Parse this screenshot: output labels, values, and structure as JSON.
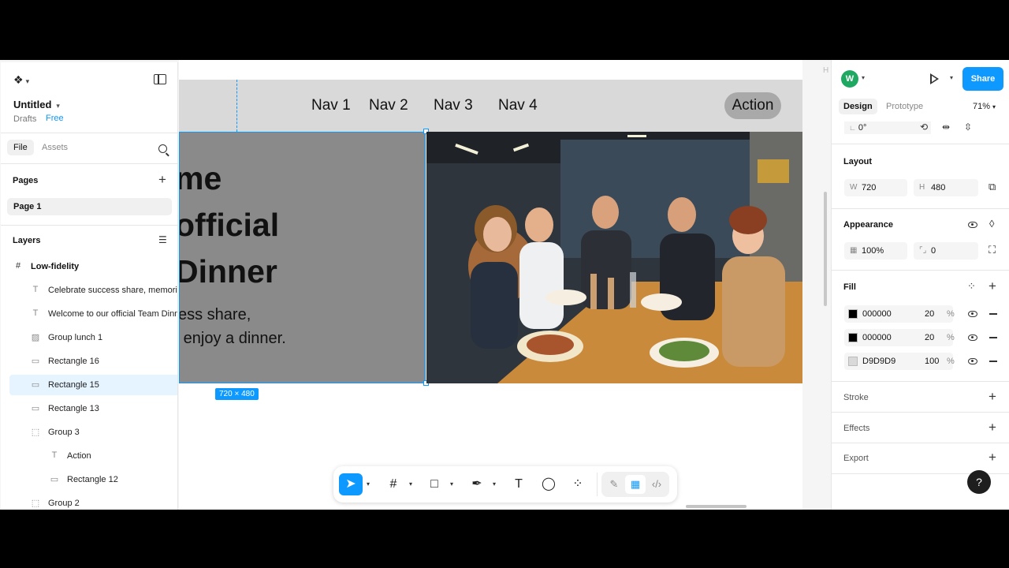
{
  "file": {
    "title": "Untitled",
    "location": "Drafts",
    "plan": "Free"
  },
  "left_tabs": {
    "file": "File",
    "assets": "Assets"
  },
  "pages": {
    "header": "Pages",
    "items": [
      "Page 1"
    ]
  },
  "layers": {
    "header": "Layers",
    "items": [
      {
        "label": "Low-fidelity",
        "icon": "#",
        "kind": "frame"
      },
      {
        "label": "Celebrate success share, memories",
        "icon": "T",
        "kind": "text"
      },
      {
        "label": "Welcome to our official Team Dinner",
        "icon": "T",
        "kind": "text"
      },
      {
        "label": "Group lunch 1",
        "icon": "▨",
        "kind": "image"
      },
      {
        "label": "Rectangle 16",
        "icon": "▭",
        "kind": "rect"
      },
      {
        "label": "Rectangle 15",
        "icon": "▭",
        "kind": "rect",
        "selected": true
      },
      {
        "label": "Rectangle 13",
        "icon": "▭",
        "kind": "rect"
      },
      {
        "label": "Group 3",
        "icon": "⬚",
        "kind": "group"
      },
      {
        "label": "Action",
        "icon": "T",
        "kind": "text",
        "indent": true
      },
      {
        "label": "Rectangle 12",
        "icon": "▭",
        "kind": "rect",
        "indent": true
      },
      {
        "label": "Group 2",
        "icon": "⬚",
        "kind": "group"
      }
    ]
  },
  "canvas": {
    "nav": [
      "Nav 1",
      "Nav 2",
      "Nav 3",
      "Nav 4"
    ],
    "action": "Action",
    "hero_lines": [
      "me",
      "official",
      "Dinner"
    ],
    "hero_sub": [
      "cess share,",
      "d enjoy a dinner."
    ],
    "size_badge": "720 × 480",
    "corner_label": "H"
  },
  "right": {
    "avatar": "W",
    "share": "Share",
    "tabs": {
      "design": "Design",
      "prototype": "Prototype"
    },
    "zoom": "71%",
    "rotation": "0°",
    "layout": {
      "header": "Layout",
      "w_label": "W",
      "w": "720",
      "h_label": "H",
      "h": "480"
    },
    "appearance": {
      "header": "Appearance",
      "opacity": "100%",
      "radius": "0"
    },
    "fill": {
      "header": "Fill",
      "rows": [
        {
          "hex": "000000",
          "opacity": "20",
          "pct": "%",
          "swatch": "#000000"
        },
        {
          "hex": "000000",
          "opacity": "20",
          "pct": "%",
          "swatch": "#000000"
        },
        {
          "hex": "D9D9D9",
          "opacity": "100",
          "pct": "%",
          "swatch": "#d9d9d9"
        }
      ]
    },
    "stroke": "Stroke",
    "effects": "Effects",
    "export": "Export",
    "help": "?"
  },
  "colors": {
    "accent": "#0d99ff",
    "avatar": "#1ea861",
    "nav_bg": "#d9d9d9",
    "hero_left": "#8a8a8a"
  }
}
